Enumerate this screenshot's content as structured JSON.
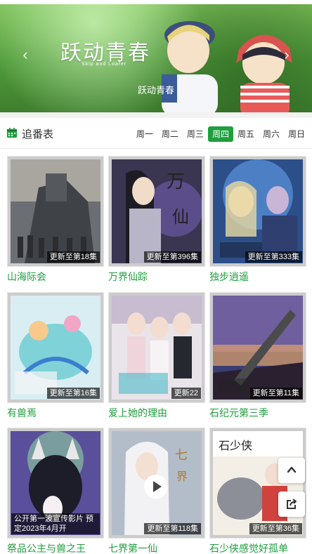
{
  "banner": {
    "logo_text": "跃动青春",
    "logo_sub": "Skip and Loafer",
    "caption": "跃动青春",
    "prev_icon": "chevron-left-icon",
    "next_icon": "chevron-right-icon",
    "prev_glyph": "‹",
    "next_glyph": "›"
  },
  "schedule": {
    "title": "追番表",
    "icon": "calendar-icon",
    "days": [
      "周一",
      "周二",
      "周三",
      "周四",
      "周五",
      "周六",
      "周日"
    ],
    "active_day": "周四"
  },
  "items": [
    {
      "title": "山海际会",
      "badge": "更新至第18集"
    },
    {
      "title": "万界仙踪",
      "badge": "更新至第396集"
    },
    {
      "title": "独步逍遥",
      "badge": "更新至第333集"
    },
    {
      "title": "有兽焉",
      "badge": "更新至第16集"
    },
    {
      "title": "爱上她的理由",
      "badge": "更新22"
    },
    {
      "title": "石纪元第三季",
      "badge": "更新至第11集"
    },
    {
      "title": "祭品公主与兽之王",
      "badge": "公开第一波宣传影片 预定2023年4月开"
    },
    {
      "title": "七界第一仙",
      "badge": "更新至第118集"
    },
    {
      "title": "石少侠感觉好孤单",
      "badge": "更新至第36集"
    }
  ],
  "floating": {
    "top_icon": "chevron-up-icon",
    "share_icon": "share-icon"
  },
  "colors": {
    "accent": "#1e9e3d"
  }
}
